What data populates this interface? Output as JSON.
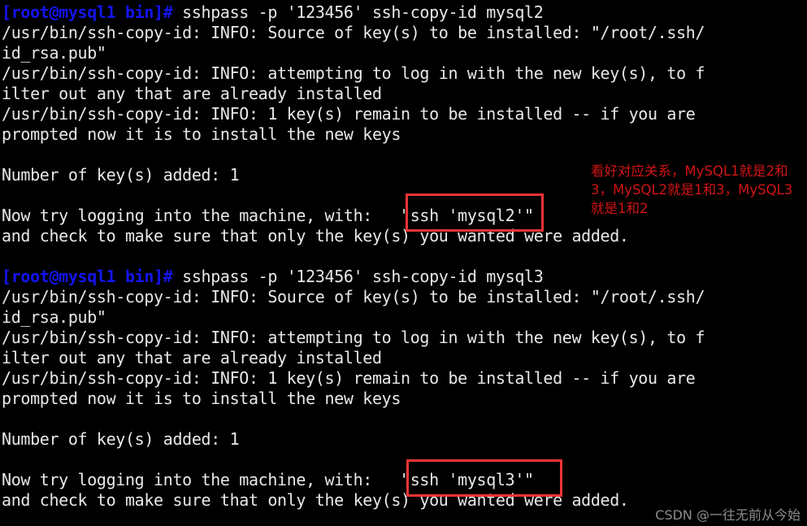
{
  "terminal": {
    "background_color": "#000000",
    "foreground_color": "#e8e8e8",
    "prompt_color": "#1414f0",
    "font_size_px": 20,
    "line_height_px": 25,
    "lines": [
      {
        "type": "prompt",
        "prompt": "[root@mysql1 bin]# ",
        "command": "sshpass -p '123456' ssh-copy-id mysql2"
      },
      {
        "type": "output",
        "text": "/usr/bin/ssh-copy-id: INFO: Source of key(s) to be installed: \"/root/.ssh/"
      },
      {
        "type": "output",
        "text": "id_rsa.pub\""
      },
      {
        "type": "output",
        "text": "/usr/bin/ssh-copy-id: INFO: attempting to log in with the new key(s), to f"
      },
      {
        "type": "output",
        "text": "ilter out any that are already installed"
      },
      {
        "type": "output",
        "text": "/usr/bin/ssh-copy-id: INFO: 1 key(s) remain to be installed -- if you are"
      },
      {
        "type": "output",
        "text": "prompted now it is to install the new keys"
      },
      {
        "type": "blank",
        "text": ""
      },
      {
        "type": "output",
        "text": "Number of key(s) added: 1"
      },
      {
        "type": "blank",
        "text": ""
      },
      {
        "type": "output",
        "text": "Now try logging into the machine, with:   \"ssh 'mysql2'\""
      },
      {
        "type": "output",
        "text": "and check to make sure that only the key(s) you wanted were added."
      },
      {
        "type": "blank",
        "text": ""
      },
      {
        "type": "prompt",
        "prompt": "[root@mysql1 bin]# ",
        "command": "sshpass -p '123456' ssh-copy-id mysql3"
      },
      {
        "type": "output",
        "text": "/usr/bin/ssh-copy-id: INFO: Source of key(s) to be installed: \"/root/.ssh/"
      },
      {
        "type": "output",
        "text": "id_rsa.pub\""
      },
      {
        "type": "output",
        "text": "/usr/bin/ssh-copy-id: INFO: attempting to log in with the new key(s), to f"
      },
      {
        "type": "output",
        "text": "ilter out any that are already installed"
      },
      {
        "type": "output",
        "text": "/usr/bin/ssh-copy-id: INFO: 1 key(s) remain to be installed -- if you are"
      },
      {
        "type": "output",
        "text": "prompted now it is to install the new keys"
      },
      {
        "type": "blank",
        "text": ""
      },
      {
        "type": "output",
        "text": "Number of key(s) added: 1"
      },
      {
        "type": "blank",
        "text": ""
      },
      {
        "type": "output",
        "text": "Now try logging into the machine, with:   \"ssh 'mysql3'\""
      },
      {
        "type": "output",
        "text": "and check to make sure that only the key(s) you wanted were added."
      }
    ]
  },
  "annotations": {
    "color": "#d21414",
    "note_text": "看好对应关系，MySQL1就是2和3，MySQL2就是1和3，MySQL3就是1和2",
    "boxes": [
      {
        "label": "\"ssh 'mysql2'\"",
        "name": "highlight-box-mysql2"
      },
      {
        "label": "\"ssh 'mysql3'\"",
        "name": "highlight-box-mysql3"
      }
    ]
  },
  "watermark": {
    "text": "CSDN @一往无前从今始",
    "color": "#9a9a9a"
  }
}
